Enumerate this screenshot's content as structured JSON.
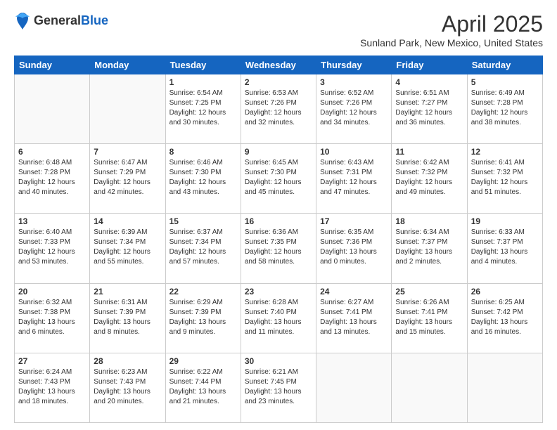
{
  "header": {
    "logo_general": "General",
    "logo_blue": "Blue",
    "month_title": "April 2025",
    "location": "Sunland Park, New Mexico, United States"
  },
  "weekdays": [
    "Sunday",
    "Monday",
    "Tuesday",
    "Wednesday",
    "Thursday",
    "Friday",
    "Saturday"
  ],
  "weeks": [
    [
      {
        "day": "",
        "info": ""
      },
      {
        "day": "",
        "info": ""
      },
      {
        "day": "1",
        "info": "Sunrise: 6:54 AM\nSunset: 7:25 PM\nDaylight: 12 hours and 30 minutes."
      },
      {
        "day": "2",
        "info": "Sunrise: 6:53 AM\nSunset: 7:26 PM\nDaylight: 12 hours and 32 minutes."
      },
      {
        "day": "3",
        "info": "Sunrise: 6:52 AM\nSunset: 7:26 PM\nDaylight: 12 hours and 34 minutes."
      },
      {
        "day": "4",
        "info": "Sunrise: 6:51 AM\nSunset: 7:27 PM\nDaylight: 12 hours and 36 minutes."
      },
      {
        "day": "5",
        "info": "Sunrise: 6:49 AM\nSunset: 7:28 PM\nDaylight: 12 hours and 38 minutes."
      }
    ],
    [
      {
        "day": "6",
        "info": "Sunrise: 6:48 AM\nSunset: 7:28 PM\nDaylight: 12 hours and 40 minutes."
      },
      {
        "day": "7",
        "info": "Sunrise: 6:47 AM\nSunset: 7:29 PM\nDaylight: 12 hours and 42 minutes."
      },
      {
        "day": "8",
        "info": "Sunrise: 6:46 AM\nSunset: 7:30 PM\nDaylight: 12 hours and 43 minutes."
      },
      {
        "day": "9",
        "info": "Sunrise: 6:45 AM\nSunset: 7:30 PM\nDaylight: 12 hours and 45 minutes."
      },
      {
        "day": "10",
        "info": "Sunrise: 6:43 AM\nSunset: 7:31 PM\nDaylight: 12 hours and 47 minutes."
      },
      {
        "day": "11",
        "info": "Sunrise: 6:42 AM\nSunset: 7:32 PM\nDaylight: 12 hours and 49 minutes."
      },
      {
        "day": "12",
        "info": "Sunrise: 6:41 AM\nSunset: 7:32 PM\nDaylight: 12 hours and 51 minutes."
      }
    ],
    [
      {
        "day": "13",
        "info": "Sunrise: 6:40 AM\nSunset: 7:33 PM\nDaylight: 12 hours and 53 minutes."
      },
      {
        "day": "14",
        "info": "Sunrise: 6:39 AM\nSunset: 7:34 PM\nDaylight: 12 hours and 55 minutes."
      },
      {
        "day": "15",
        "info": "Sunrise: 6:37 AM\nSunset: 7:34 PM\nDaylight: 12 hours and 57 minutes."
      },
      {
        "day": "16",
        "info": "Sunrise: 6:36 AM\nSunset: 7:35 PM\nDaylight: 12 hours and 58 minutes."
      },
      {
        "day": "17",
        "info": "Sunrise: 6:35 AM\nSunset: 7:36 PM\nDaylight: 13 hours and 0 minutes."
      },
      {
        "day": "18",
        "info": "Sunrise: 6:34 AM\nSunset: 7:37 PM\nDaylight: 13 hours and 2 minutes."
      },
      {
        "day": "19",
        "info": "Sunrise: 6:33 AM\nSunset: 7:37 PM\nDaylight: 13 hours and 4 minutes."
      }
    ],
    [
      {
        "day": "20",
        "info": "Sunrise: 6:32 AM\nSunset: 7:38 PM\nDaylight: 13 hours and 6 minutes."
      },
      {
        "day": "21",
        "info": "Sunrise: 6:31 AM\nSunset: 7:39 PM\nDaylight: 13 hours and 8 minutes."
      },
      {
        "day": "22",
        "info": "Sunrise: 6:29 AM\nSunset: 7:39 PM\nDaylight: 13 hours and 9 minutes."
      },
      {
        "day": "23",
        "info": "Sunrise: 6:28 AM\nSunset: 7:40 PM\nDaylight: 13 hours and 11 minutes."
      },
      {
        "day": "24",
        "info": "Sunrise: 6:27 AM\nSunset: 7:41 PM\nDaylight: 13 hours and 13 minutes."
      },
      {
        "day": "25",
        "info": "Sunrise: 6:26 AM\nSunset: 7:41 PM\nDaylight: 13 hours and 15 minutes."
      },
      {
        "day": "26",
        "info": "Sunrise: 6:25 AM\nSunset: 7:42 PM\nDaylight: 13 hours and 16 minutes."
      }
    ],
    [
      {
        "day": "27",
        "info": "Sunrise: 6:24 AM\nSunset: 7:43 PM\nDaylight: 13 hours and 18 minutes."
      },
      {
        "day": "28",
        "info": "Sunrise: 6:23 AM\nSunset: 7:43 PM\nDaylight: 13 hours and 20 minutes."
      },
      {
        "day": "29",
        "info": "Sunrise: 6:22 AM\nSunset: 7:44 PM\nDaylight: 13 hours and 21 minutes."
      },
      {
        "day": "30",
        "info": "Sunrise: 6:21 AM\nSunset: 7:45 PM\nDaylight: 13 hours and 23 minutes."
      },
      {
        "day": "",
        "info": ""
      },
      {
        "day": "",
        "info": ""
      },
      {
        "day": "",
        "info": ""
      }
    ]
  ]
}
